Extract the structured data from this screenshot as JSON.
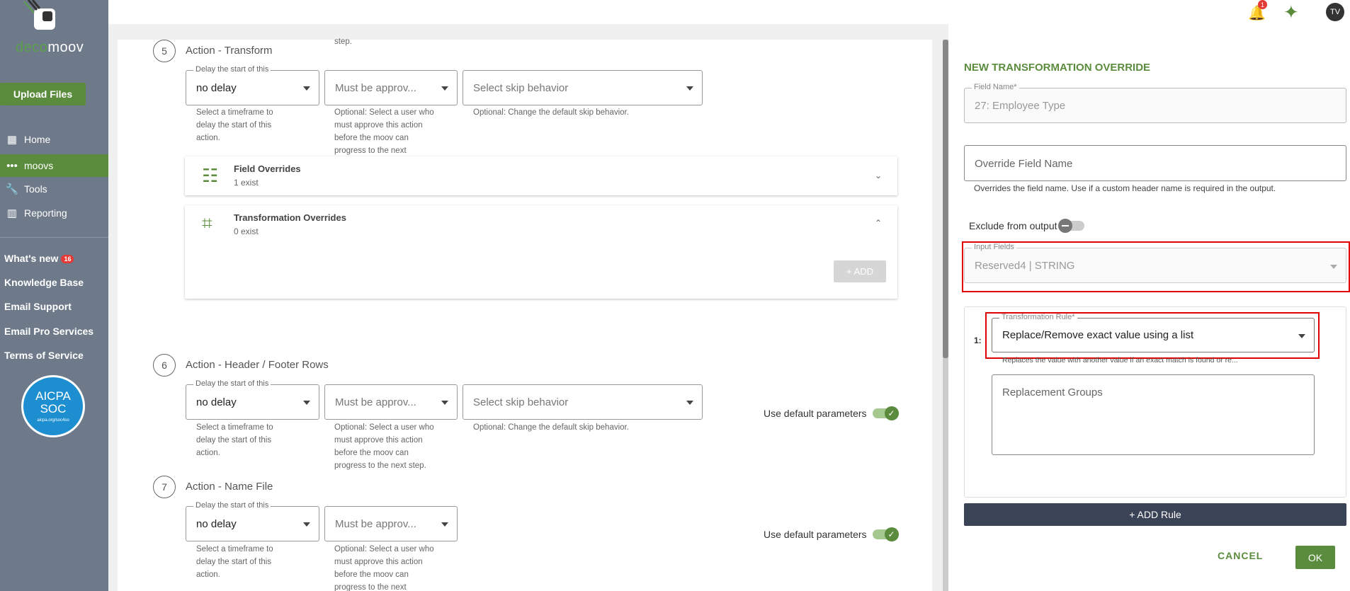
{
  "app": {
    "logo_text_a": "deco",
    "logo_text_b": "moov"
  },
  "sidebar": {
    "upload_label": "Upload Files",
    "items": [
      {
        "label": "Home",
        "icon": "home-grid-icon"
      },
      {
        "label": "moovs",
        "icon": "dots-icon"
      },
      {
        "label": "Tools",
        "icon": "wrench-icon"
      },
      {
        "label": "Reporting",
        "icon": "chart-icon"
      }
    ],
    "links": {
      "whats_new": "What's new",
      "whats_new_badge": "16",
      "knowledge_base": "Knowledge Base",
      "email_support": "Email Support",
      "email_pro": "Email Pro Services",
      "terms": "Terms of Service"
    },
    "aicpa": {
      "line1": "AICPA",
      "line2": "SOC",
      "small": "aicpa.org/soc4so"
    }
  },
  "topbar": {
    "bell_badge": "1",
    "avatar": "TV"
  },
  "steps": {
    "s5": {
      "number": "5",
      "title": "Action - Transform",
      "cutoff": "step.",
      "delay_label": "Delay the start of this",
      "delay_value": "no delay",
      "delay_help": "Select a timeframe to delay the start of this action.",
      "approve_value": "Must be approv...",
      "approve_help": "Optional: Select a user who must approve this action before the moov can progress to the next",
      "skip_value": "Select skip behavior",
      "skip_help": "Optional: Change the default skip behavior."
    },
    "field_overrides": {
      "title": "Field Overrides",
      "sub": "1 exist"
    },
    "trans_overrides": {
      "title": "Transformation Overrides",
      "sub": "0 exist",
      "add": "+ ADD"
    },
    "s6": {
      "number": "6",
      "title": "Action - Header / Footer Rows",
      "delay_label": "Delay the start of this",
      "delay_value": "no delay",
      "delay_help": "Select a timeframe to delay the start of this action.",
      "approve_value": "Must be approv...",
      "approve_help": "Optional: Select a user who must approve this action before the moov can progress to the next step.",
      "skip_value": "Select skip behavior",
      "skip_help": "Optional: Change the default skip behavior.",
      "default_params": "Use default parameters"
    },
    "s7": {
      "number": "7",
      "title": "Action - Name File",
      "delay_label": "Delay the start of this",
      "delay_value": "no delay",
      "delay_help": "Select a timeframe to delay the start of this action.",
      "approve_value": "Must be approv...",
      "approve_help": "Optional: Select a user who must approve this action before the moov can progress to the next",
      "default_params": "Use default parameters"
    }
  },
  "override": {
    "title": "NEW TRANSFORMATION OVERRIDE",
    "field_name_label": "Field Name*",
    "field_name_value": "27: Employee Type",
    "override_placeholder": "Override Field Name",
    "override_help": "Overrides the field name. Use if a custom header name is required in the output.",
    "exclude_label": "Exclude from output",
    "input_fields_label": "Input Fields",
    "input_fields_value": "Reserved4 | STRING",
    "rule_index": "1:",
    "rule_label": "Transformation Rule*",
    "rule_value": "Replace/Remove exact value using a list",
    "rule_help": "Replaces the value with another value if an exact match is found or re...",
    "replacement_placeholder": "Replacement Groups",
    "add_rule": "+ ADD Rule",
    "cancel": "CANCEL",
    "ok": "OK"
  },
  "colors": {
    "brand_green": "#5b8c3e",
    "sidebar": "#6e7a8a",
    "highlight": "#e00000"
  }
}
